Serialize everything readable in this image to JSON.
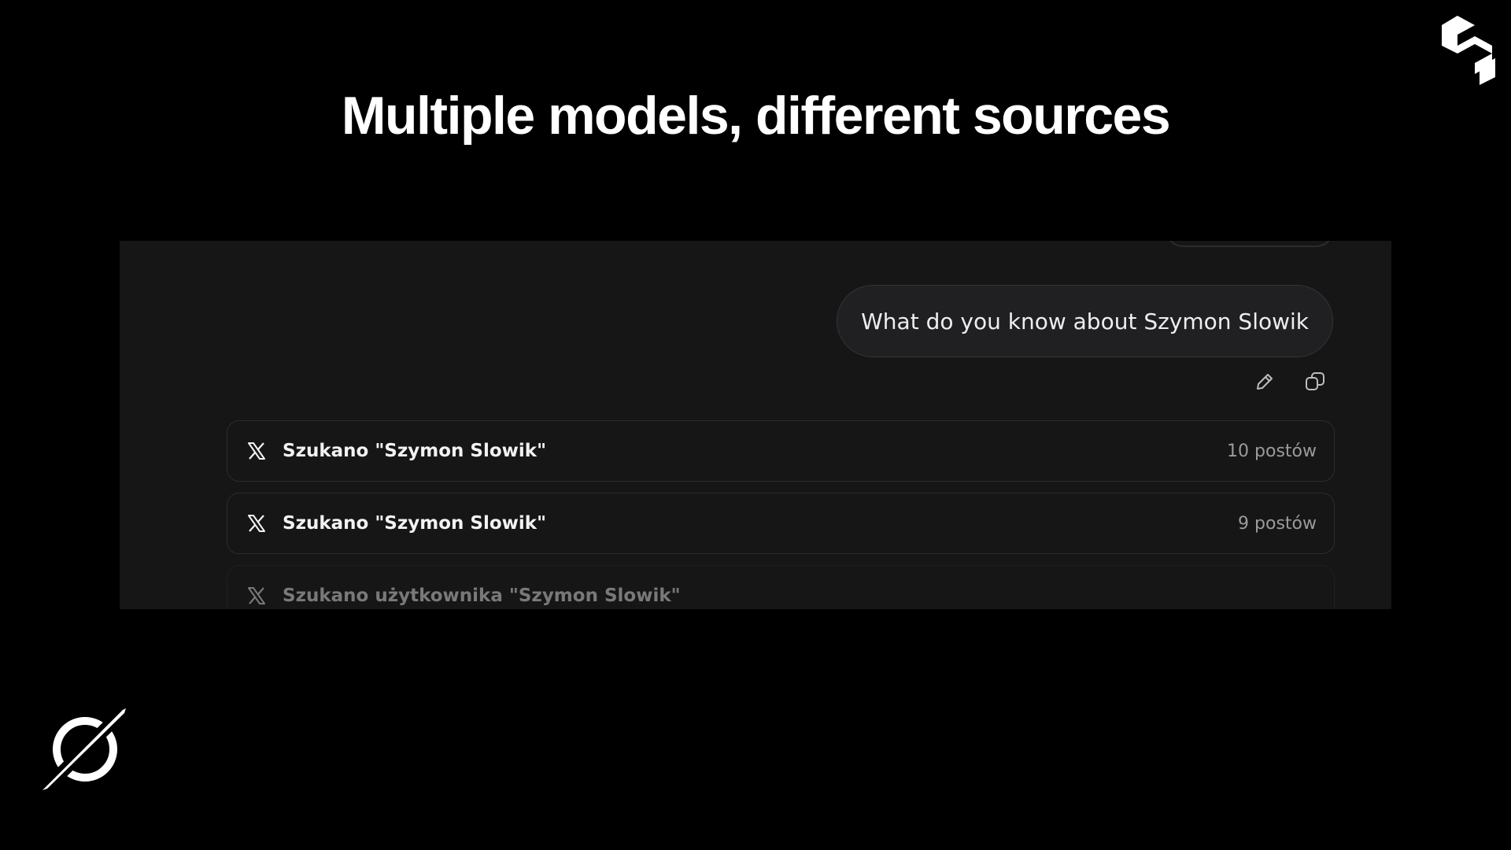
{
  "slide": {
    "title": "Multiple models, different sources"
  },
  "chat": {
    "user_message": "What do you know about Szymon Slowik",
    "actions": {
      "edit_icon": "pencil-icon",
      "copy_icon": "copy-icon"
    },
    "search_results": [
      {
        "icon": "x-logo-icon",
        "label": "Szukano \"Szymon Slowik\"",
        "count": "10 postów"
      },
      {
        "icon": "x-logo-icon",
        "label": "Szukano \"Szymon Slowik\"",
        "count": "9 postów"
      },
      {
        "icon": "x-logo-icon",
        "label": "Szukano użytkownika \"Szymon Slowik\"",
        "count": ""
      }
    ]
  },
  "colors": {
    "slide_background": "#000000",
    "panel_background": "#161617",
    "bubble_background": "#202022",
    "border": "#2c2c2f",
    "muted_text": "#9b9b9f"
  }
}
